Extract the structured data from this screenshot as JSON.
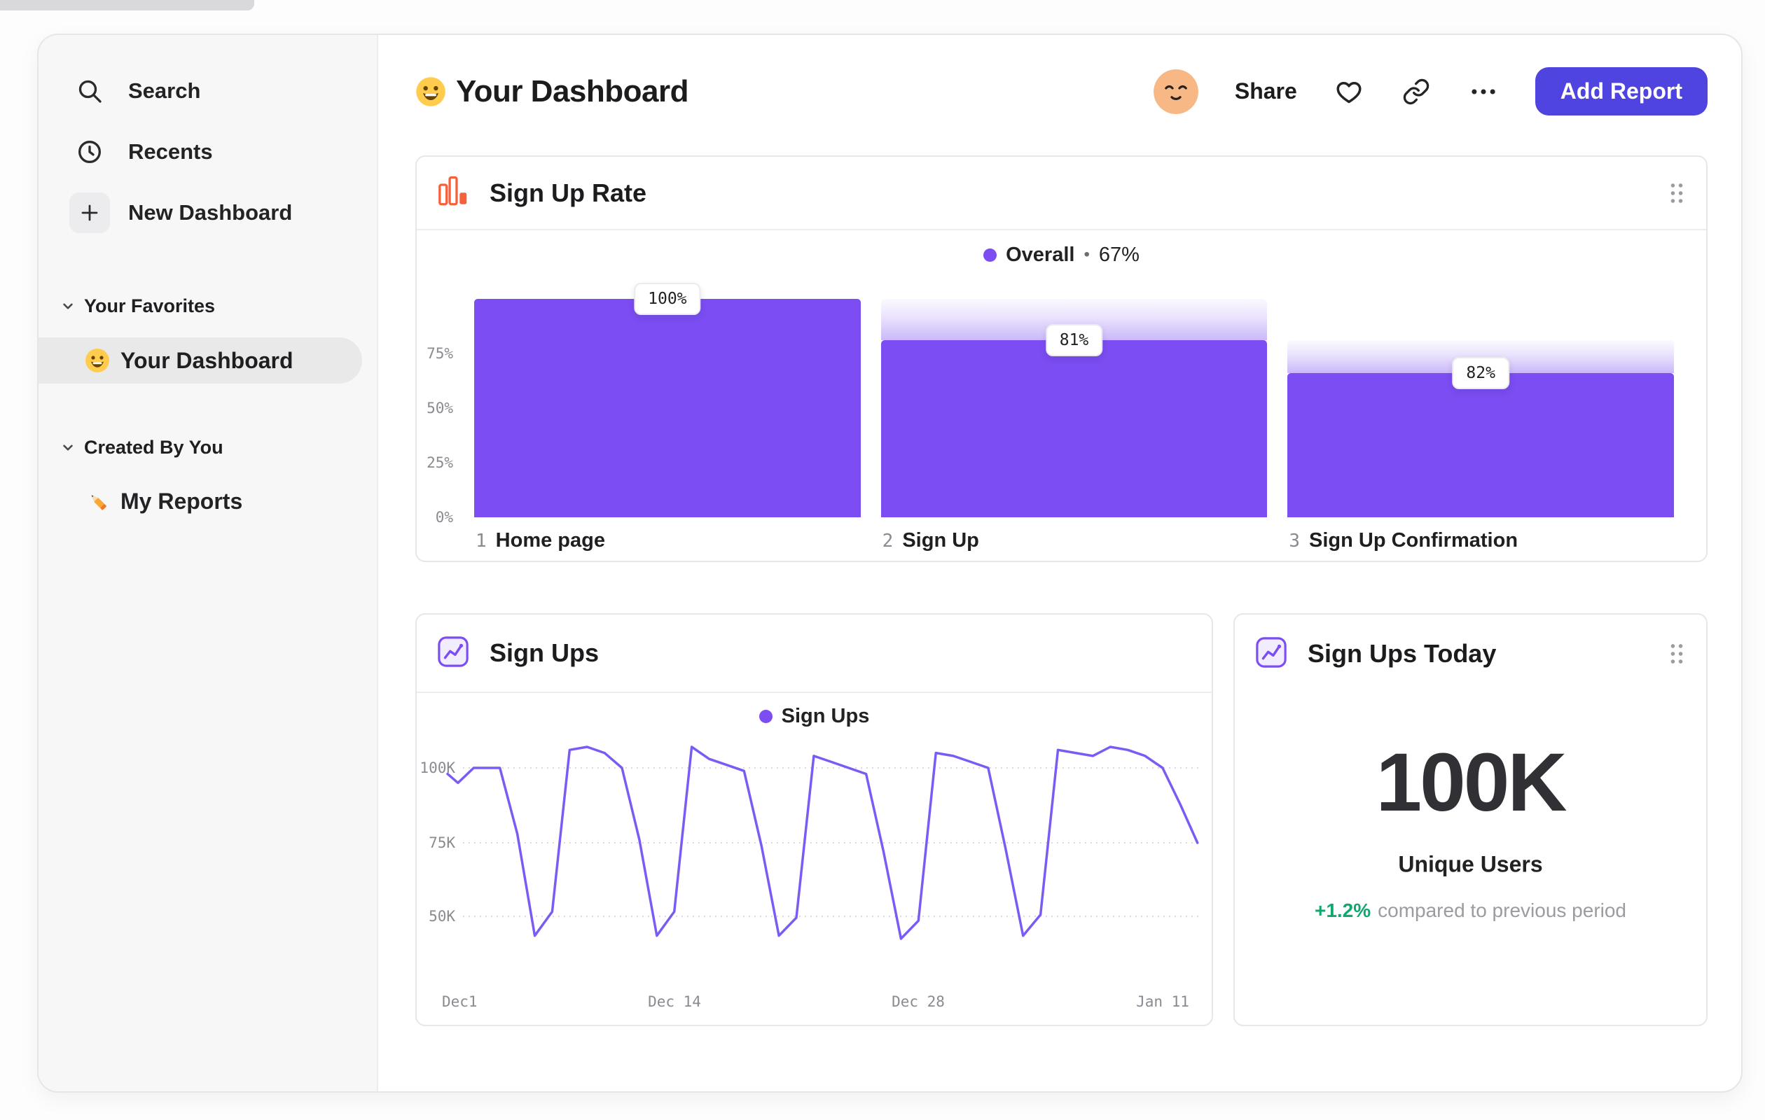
{
  "colors": {
    "accent_purple": "#7B4DF2",
    "line_purple": "#7A5CF5",
    "button_indigo": "#4F44E0",
    "funnel_icon_orange": "#F5603D",
    "positive_green": "#0FA86E"
  },
  "sidebar": {
    "items": [
      {
        "label": "Search",
        "icon": "search-icon"
      },
      {
        "label": "Recents",
        "icon": "clock-icon"
      },
      {
        "label": "New Dashboard",
        "icon": "plus-icon"
      }
    ],
    "sections": [
      {
        "title": "Your Favorites",
        "items": [
          {
            "label": "Your Dashboard",
            "icon": "smiley-emoji",
            "selected": true
          }
        ]
      },
      {
        "title": "Created By You",
        "items": [
          {
            "label": "My Reports",
            "icon": "pencil-emoji",
            "selected": false
          }
        ]
      }
    ]
  },
  "header": {
    "title": "Your Dashboard",
    "share_label": "Share",
    "add_report_label": "Add Report"
  },
  "cards": {
    "funnel": {
      "title": "Sign Up Rate",
      "legend_label": "Overall",
      "legend_separator": "•",
      "legend_value": "67%",
      "y_ticks": [
        "75%",
        "50%",
        "25%",
        "0%"
      ]
    },
    "line": {
      "title": "Sign Ups",
      "legend_label": "Sign Ups",
      "y_ticks": [
        "100K",
        "75K",
        "50K"
      ],
      "x_ticks": [
        "Dec1",
        "Dec 14",
        "Dec 28",
        "Jan 11"
      ]
    },
    "metric": {
      "title": "Sign Ups Today",
      "value": "100K",
      "label": "Unique Users",
      "delta": "+1.2%",
      "delta_caption": "compared to previous period"
    }
  },
  "chart_data": [
    {
      "type": "bar",
      "subtype": "funnel",
      "title": "Sign Up Rate",
      "overall_conversion": "67%",
      "ylim": [
        0,
        100
      ],
      "y_tick_labels": [
        "75%",
        "50%",
        "25%",
        "0%"
      ],
      "steps": [
        {
          "index": "1",
          "label": "Home page",
          "step_conversion": "100%",
          "height_pct": 100,
          "prev_height_pct": 100
        },
        {
          "index": "2",
          "label": "Sign Up",
          "step_conversion": "81%",
          "height_pct": 81,
          "prev_height_pct": 100
        },
        {
          "index": "3",
          "label": "Sign Up Confirmation",
          "step_conversion": "82%",
          "height_pct": 66,
          "prev_height_pct": 81
        }
      ]
    },
    {
      "type": "line",
      "title": "Sign Ups",
      "series_name": "Sign Ups",
      "x_axis": {
        "tick_labels": [
          "Dec1",
          "Dec 14",
          "Dec 28",
          "Jan 11"
        ],
        "tick_days": [
          0,
          13,
          27,
          41
        ]
      },
      "y_axis": {
        "tick_labels": [
          "100K",
          "75K",
          "50K"
        ],
        "tick_values": [
          100000,
          75000,
          50000
        ]
      },
      "unit": "thousands_of_signups_per_day",
      "points": [
        [
          0,
          98
        ],
        [
          0.6,
          95
        ],
        [
          1.5,
          100
        ],
        [
          3,
          100
        ],
        [
          4,
          78
        ],
        [
          5,
          44
        ],
        [
          6,
          52
        ],
        [
          7,
          106
        ],
        [
          8,
          107
        ],
        [
          9,
          105
        ],
        [
          10,
          100
        ],
        [
          11,
          76
        ],
        [
          12,
          44
        ],
        [
          13,
          52
        ],
        [
          14,
          107
        ],
        [
          15,
          103
        ],
        [
          16,
          101
        ],
        [
          17,
          99
        ],
        [
          18,
          74
        ],
        [
          19,
          44
        ],
        [
          20,
          50
        ],
        [
          21,
          104
        ],
        [
          22,
          102
        ],
        [
          23,
          100
        ],
        [
          24,
          98
        ],
        [
          25,
          72
        ],
        [
          26,
          43
        ],
        [
          27,
          49
        ],
        [
          28,
          105
        ],
        [
          29,
          104
        ],
        [
          30,
          102
        ],
        [
          31,
          100
        ],
        [
          32,
          73
        ],
        [
          33,
          44
        ],
        [
          34,
          51
        ],
        [
          35,
          106
        ],
        [
          36,
          105
        ],
        [
          37,
          104
        ],
        [
          38,
          107
        ],
        [
          39,
          106
        ],
        [
          40,
          104
        ],
        [
          41,
          100
        ],
        [
          42,
          88
        ],
        [
          43,
          75
        ]
      ]
    }
  ]
}
